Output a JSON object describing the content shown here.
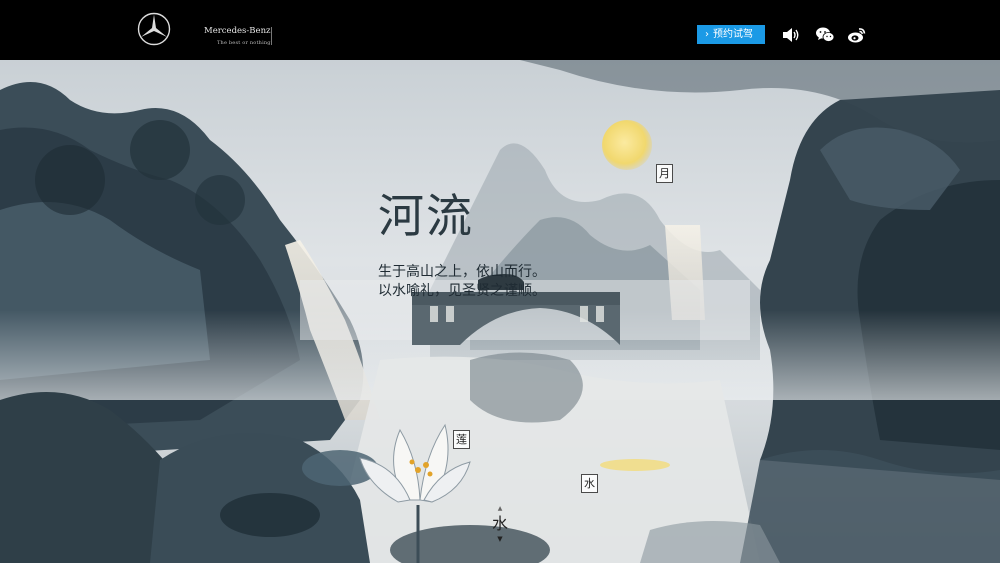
{
  "header": {
    "brand": "Mercedes-Benz",
    "tagline": "The best or nothing.",
    "cta_label": "预约试驾",
    "icons": [
      "mercedes-star-icon",
      "chevron-right-icon",
      "sound-icon",
      "wechat-icon",
      "weibo-icon"
    ]
  },
  "main": {
    "title": "河流",
    "poem_line1": "生于高山之上，依山而行。",
    "poem_line2": "以水喻礼，见圣贤之谨顺。"
  },
  "tags": {
    "moon": "月",
    "lotus": "莲",
    "water": "水"
  },
  "bottom_nav": {
    "up_arrow": "▲",
    "label": "水",
    "down_arrow": "▼"
  },
  "colors": {
    "cta_blue": "#1b9ae6",
    "ink_dark": "#1f2b33",
    "moon_yellow": "#f3dc7a"
  }
}
